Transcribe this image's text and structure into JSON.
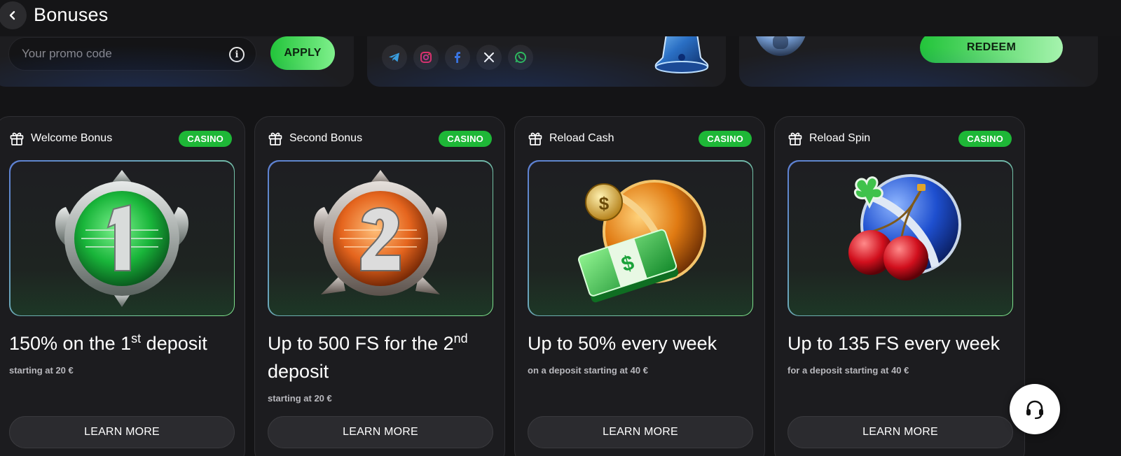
{
  "header": {
    "title": "Bonuses",
    "back_icon": "chevron-left-icon"
  },
  "promo": {
    "placeholder": "Your promo code",
    "value": "",
    "apply_label": "APPLY",
    "info_icon": "info-icon"
  },
  "socials": {
    "items": [
      "telegram-icon",
      "instagram-icon",
      "facebook-icon",
      "x-icon",
      "whatsapp-icon"
    ]
  },
  "redeem": {
    "label": "REDEEM"
  },
  "cards": [
    {
      "title": "Welcome Bonus",
      "tag": "CASINO",
      "headline_pre": "150% on the 1",
      "headline_sup": "st",
      "headline_post": " deposit",
      "sub": "starting at 20 €",
      "button": "LEARN MORE",
      "art": "medal-1"
    },
    {
      "title": "Second Bonus",
      "tag": "CASINO",
      "headline_pre": "Up to 500 FS for the 2",
      "headline_sup": "nd",
      "headline_post": " deposit",
      "sub": "starting at 20 €",
      "button": "LEARN MORE",
      "art": "medal-2"
    },
    {
      "title": "Reload Cash",
      "tag": "CASINO",
      "headline_pre": "Up to 50% every week",
      "headline_sup": "",
      "headline_post": "",
      "sub": "on a deposit starting at 40 €",
      "button": "LEARN MORE",
      "art": "cash-ball"
    },
    {
      "title": "Reload Spin",
      "tag": "CASINO",
      "headline_pre": "Up to 135 FS every week",
      "headline_sup": "",
      "headline_post": "",
      "sub": "for a deposit starting at 40 €",
      "button": "LEARN MORE",
      "art": "cherry-ball"
    }
  ],
  "colors": {
    "accent_green": "#1eb737",
    "button_green": "#22c43a",
    "background": "#141416",
    "card": "#1c1c1f"
  },
  "support": {
    "icon": "headset-icon"
  }
}
